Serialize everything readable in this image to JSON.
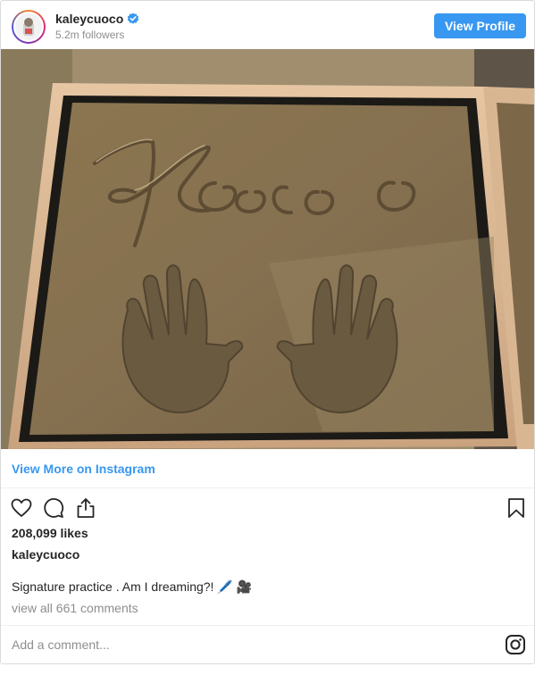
{
  "header": {
    "username": "kaleycuoco",
    "followers": "5.2m followers",
    "view_profile_label": "View Profile",
    "verified_color": "#3897f0"
  },
  "photo": {
    "signature_text": "KCuoco"
  },
  "links": {
    "view_more_label": "View More on Instagram"
  },
  "actions": {
    "icons": [
      "heart-icon",
      "comment-icon",
      "share-icon",
      "bookmark-icon"
    ]
  },
  "post": {
    "likes": "208,099 likes",
    "caption_user": "kaleycuoco",
    "caption": "Signature practice . Am I dreaming?! 🖊️ 🎥",
    "view_comments": "view all 661 comments"
  },
  "footer": {
    "add_comment_placeholder": "Add a comment...",
    "logo_icon": "instagram-icon"
  },
  "colors": {
    "accent": "#3897f0",
    "muted": "#8e8e8e",
    "text": "#262626"
  }
}
